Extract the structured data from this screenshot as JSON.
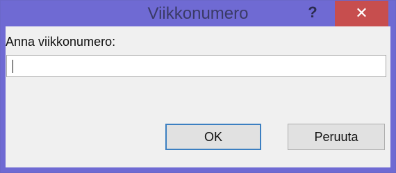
{
  "window": {
    "title": "Viikkonumero",
    "help_label": "?",
    "close_label": "✕"
  },
  "dialog": {
    "prompt": "Anna viikkonumero:",
    "input_value": "",
    "ok_label": "OK",
    "cancel_label": "Peruuta"
  },
  "colors": {
    "titlebar": "#6f6ad3",
    "close_button": "#c74e4e",
    "dialog_body": "#f0f0f0",
    "focus_border": "#3c7fc1"
  },
  "icons": {
    "help": "question-mark-icon",
    "close": "close-icon"
  }
}
